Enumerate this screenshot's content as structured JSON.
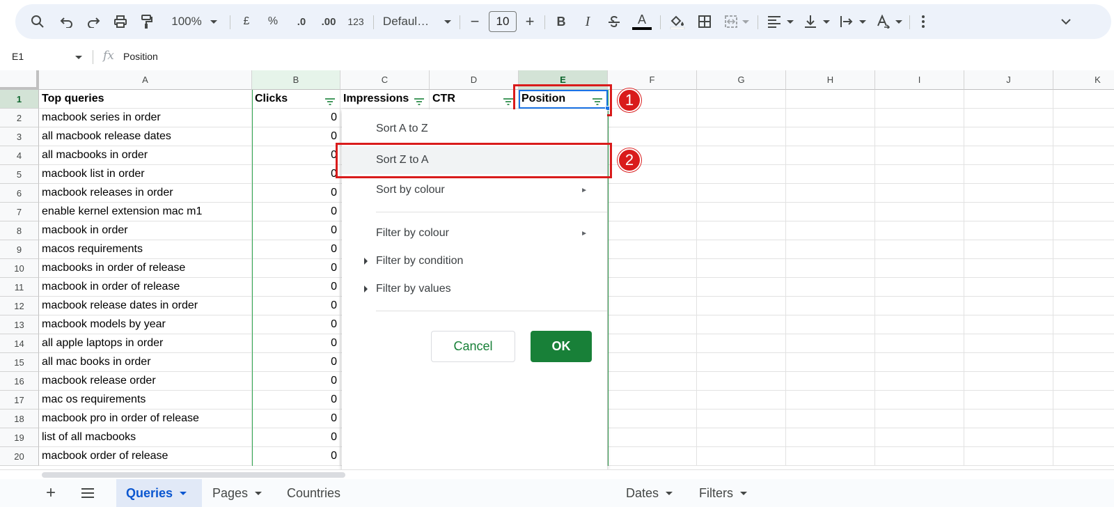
{
  "toolbar": {
    "zoom": "100%",
    "currency": "£",
    "percent": "%",
    "decrease_decimal": ".0",
    "increase_decimal": ".00",
    "number_format": "123",
    "font": "Defaul…",
    "font_size": "10",
    "bold": "B",
    "italic": "I",
    "text_color_glyph": "A"
  },
  "formula_bar": {
    "name_box": "E1",
    "fx": "fx",
    "formula": "Position"
  },
  "columns": [
    "A",
    "B",
    "C",
    "D",
    "E",
    "F",
    "G",
    "H",
    "I",
    "J",
    "K"
  ],
  "header_row": {
    "a": "Top queries",
    "b": "Clicks",
    "c": "Impressions",
    "d": "CTR",
    "e": "Position"
  },
  "rows": [
    {
      "num": "1"
    },
    {
      "num": "2",
      "query": "macbook series in order",
      "clicks": "0"
    },
    {
      "num": "3",
      "query": "all macbook release dates",
      "clicks": "0"
    },
    {
      "num": "4",
      "query": "all macbooks in order",
      "clicks": "0"
    },
    {
      "num": "5",
      "query": "macbook list in order",
      "clicks": "0"
    },
    {
      "num": "6",
      "query": "macbook releases in order",
      "clicks": "0"
    },
    {
      "num": "7",
      "query": "enable kernel extension mac m1",
      "clicks": "0"
    },
    {
      "num": "8",
      "query": "macbook in order",
      "clicks": "0"
    },
    {
      "num": "9",
      "query": "macos requirements",
      "clicks": "0"
    },
    {
      "num": "10",
      "query": "macbooks in order of release",
      "clicks": "0"
    },
    {
      "num": "11",
      "query": "macbook in order of release",
      "clicks": "0"
    },
    {
      "num": "12",
      "query": "macbook release dates in order",
      "clicks": "0"
    },
    {
      "num": "13",
      "query": "macbook models by year",
      "clicks": "0"
    },
    {
      "num": "14",
      "query": "all apple laptops in order",
      "clicks": "0"
    },
    {
      "num": "15",
      "query": "all mac books in order",
      "clicks": "0"
    },
    {
      "num": "16",
      "query": "macbook release order",
      "clicks": "0"
    },
    {
      "num": "17",
      "query": "mac os requirements",
      "clicks": "0"
    },
    {
      "num": "18",
      "query": "macbook pro in order of release",
      "clicks": "0"
    },
    {
      "num": "19",
      "query": "list of all macbooks",
      "clicks": "0"
    },
    {
      "num": "20",
      "query": "macbook order of release",
      "clicks": "0"
    }
  ],
  "filter_menu": {
    "sort_az": "Sort A to Z",
    "sort_za": "Sort Z to A",
    "sort_by_colour": "Sort by colour",
    "filter_by_colour": "Filter by colour",
    "filter_by_condition": "Filter by condition",
    "filter_by_values": "Filter by values",
    "cancel": "Cancel",
    "ok": "OK",
    "submenu_arrow": "►"
  },
  "annotations": {
    "step1": "1",
    "step2": "2"
  },
  "sheet_tabs": {
    "add": "+",
    "tabs": [
      "Queries",
      "Pages",
      "Countries",
      "Dates",
      "Filters"
    ],
    "active": "Queries"
  },
  "colors": {
    "accent_green": "#188038",
    "selection_blue": "#1a73e8",
    "annotation_red": "#d91b1b",
    "active_tab_text": "#0b57d0"
  }
}
